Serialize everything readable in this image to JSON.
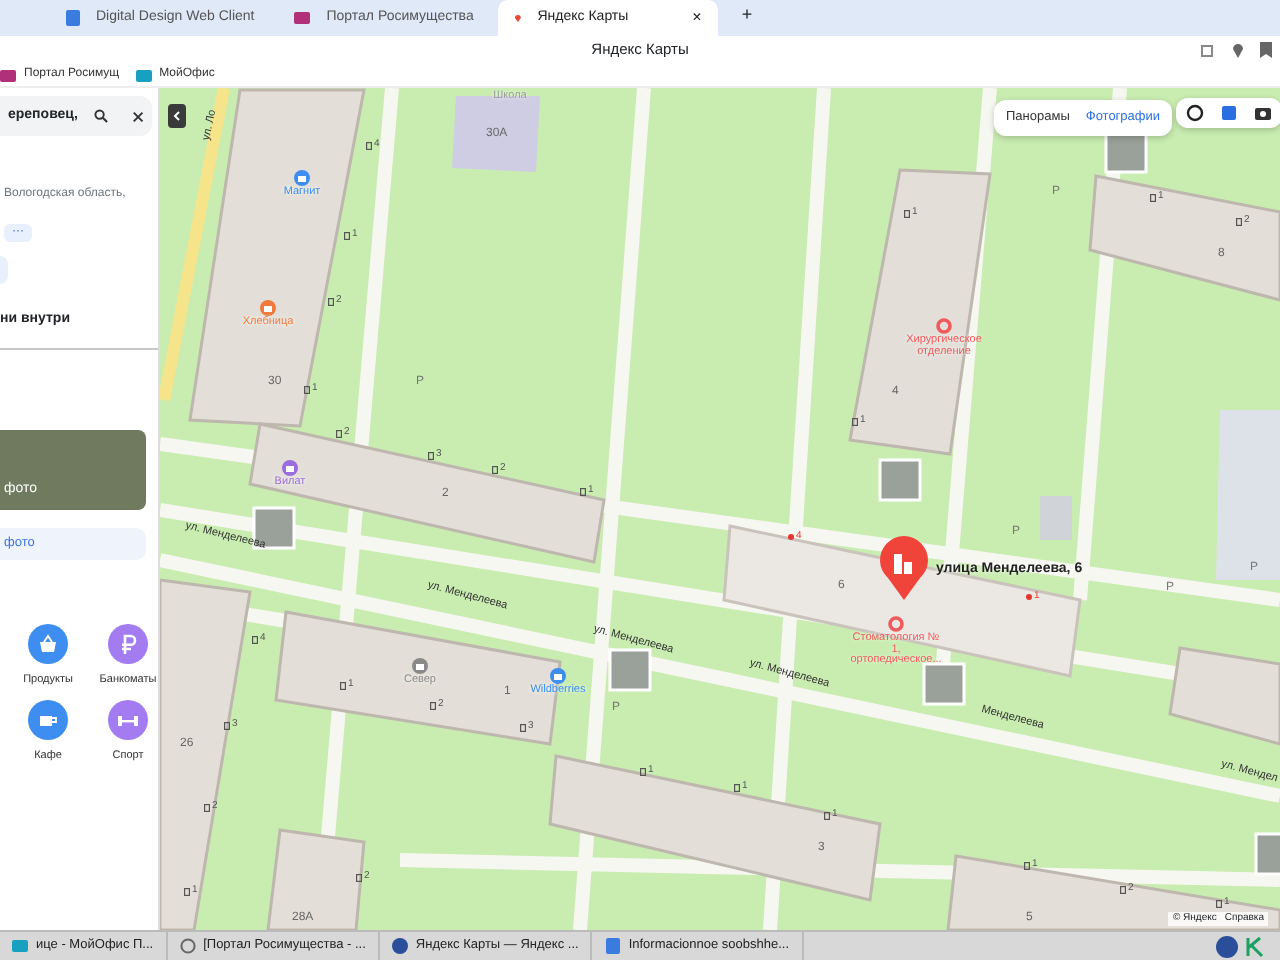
{
  "browser": {
    "tabs": [
      {
        "label": "Digital Design Web Client",
        "selected": false,
        "kind": "doc"
      },
      {
        "label": "Портал Росимущества",
        "selected": false,
        "kind": "folder"
      },
      {
        "label": "Яндекс Карты",
        "selected": true,
        "kind": "pin"
      }
    ],
    "new_tab": "+",
    "close_tab": "×",
    "title": "Яндекс Карты",
    "bookmarks": [
      {
        "label": "Портал Росимущ",
        "kind": "folder"
      },
      {
        "label": "МойОфис",
        "kind": "office"
      }
    ]
  },
  "sidebar": {
    "search": {
      "value": "ереповец,"
    },
    "region": "Вологодская область,",
    "more": "···",
    "heading": "ни внутри",
    "photo_caption": "фото",
    "photo_button": "фото",
    "categories": [
      {
        "label": "Продукты",
        "color": "#3d8ef0",
        "kind": "basket"
      },
      {
        "label": "Банкоматы",
        "color": "#a27cf0",
        "kind": "ruble"
      },
      {
        "label": "Кафе",
        "color": "#3d8ef0",
        "kind": "cup"
      },
      {
        "label": "Спорт",
        "color": "#a27cf0",
        "kind": "dumbbell"
      }
    ]
  },
  "map": {
    "layers": [
      {
        "label": "Панорамы",
        "selected": false
      },
      {
        "label": "Фотографии",
        "selected": true
      }
    ],
    "streets": [
      "ул. Ло",
      "ул. Менделеева",
      "ул. Менделеева",
      "ул. Менделеева",
      "ул. Менделеева",
      "Менделеева",
      "ул. Мендел"
    ],
    "houses": [
      "30А",
      "30",
      "2",
      "1",
      "26",
      "28А",
      "4",
      "8",
      "6",
      "3",
      "5"
    ],
    "pois": [
      {
        "label": "Школа",
        "color": "#9a9a9a",
        "kind": "plain"
      },
      {
        "label": "Магнит",
        "color": "#3d8ef0",
        "kind": "shop"
      },
      {
        "label": "Хлебница",
        "color": "#f07a3c",
        "kind": "shop"
      },
      {
        "label": "Вилат",
        "color": "#9a6ce0",
        "kind": "shop"
      },
      {
        "label": "Север",
        "color": "#8a8a8a",
        "kind": "shop"
      },
      {
        "label": "Wildberries",
        "color": "#3d8ef0",
        "kind": "shop"
      },
      {
        "label": "Хирургическое отделение",
        "color": "#f05a5a",
        "kind": "medical"
      },
      {
        "label": "Стоматология № 1, ортопедическое...",
        "color": "#f05a5a",
        "kind": "medical"
      }
    ],
    "entrances": [
      {
        "number": "4",
        "kind": "door"
      },
      {
        "number": "1",
        "kind": "door"
      },
      {
        "number": "2",
        "kind": "door"
      },
      {
        "number": "1",
        "kind": "door"
      },
      {
        "number": "2",
        "kind": "door"
      },
      {
        "number": "3",
        "kind": "door"
      },
      {
        "number": "2",
        "kind": "door"
      },
      {
        "number": "1",
        "kind": "door"
      },
      {
        "number": "4",
        "kind": "door"
      },
      {
        "number": "1",
        "kind": "door"
      },
      {
        "number": "2",
        "kind": "door"
      },
      {
        "number": "3",
        "kind": "door"
      },
      {
        "number": "3",
        "kind": "door"
      },
      {
        "number": "2",
        "kind": "door"
      },
      {
        "number": "1",
        "kind": "door"
      },
      {
        "number": "2",
        "kind": "door"
      },
      {
        "number": "1",
        "kind": "door"
      },
      {
        "number": "1",
        "kind": "door"
      },
      {
        "number": "1",
        "kind": "door"
      },
      {
        "number": "2",
        "kind": "door"
      },
      {
        "number": "4",
        "kind": "marked"
      },
      {
        "number": "1",
        "kind": "marked"
      },
      {
        "number": "1",
        "kind": "door"
      },
      {
        "number": "1",
        "kind": "door"
      },
      {
        "number": "1",
        "kind": "door"
      },
      {
        "number": "1",
        "kind": "door"
      },
      {
        "number": "2",
        "kind": "door"
      },
      {
        "number": "1",
        "kind": "door"
      }
    ],
    "parking": [
      "P",
      "P",
      "P",
      "P",
      "P",
      "P"
    ],
    "selected_place": "улица Менделеева, 6",
    "footer": [
      "© Яндекс",
      "Справка"
    ]
  },
  "taskbar": [
    {
      "label": "ице - МойОфис П...",
      "kind": "office"
    },
    {
      "label": "[Портал Росимущества - ...",
      "kind": "browser"
    },
    {
      "label": "Яндекс Карты — Яндекс ...",
      "kind": "yandex"
    },
    {
      "label": "Informacionnoe soobshhe...",
      "kind": "doc"
    }
  ]
}
